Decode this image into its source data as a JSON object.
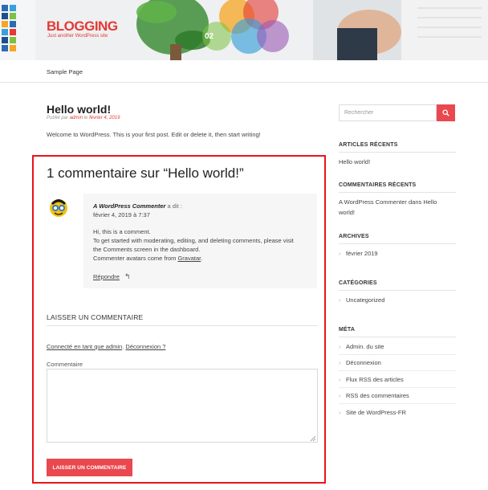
{
  "site": {
    "title": "BLOGGING",
    "tagline": "Just another WordPress site"
  },
  "nav": {
    "items": [
      "Sample Page"
    ]
  },
  "post": {
    "title": "Hello world!",
    "meta_prefix": "Publié par",
    "meta_author": "admin",
    "meta_mid": "le",
    "meta_date": "février 4, 2019",
    "content": "Welcome to WordPress. This is your first post. Edit or delete it, then start writing!"
  },
  "comments": {
    "title": "1 commentaire sur “Hello world!”",
    "items": [
      {
        "author": "A WordPress Commenter",
        "says": "a dit :",
        "date": "février 4, 2019 à 7:37",
        "lines": [
          "Hi, this is a comment.",
          "To get started with moderating, editing, and deleting comments, please visit",
          "the Comments screen in the dashboard.",
          "Commenter avatars come from"
        ],
        "gravatar_link": "Gravatar",
        "reply": "Répondre"
      }
    ]
  },
  "respond": {
    "title": "LAISSER UN COMMENTAIRE",
    "logged_in_prefix": "Connecté en tant que admin",
    "logout": "Déconnexion ?",
    "comment_label": "Commentaire",
    "textarea_value": "",
    "submit_label": "LAISSER UN COMMENTAIRE"
  },
  "sidebar": {
    "search_placeholder": "Rechercher",
    "recent_posts": {
      "title": "ARTICLES RÉCENTS",
      "items": [
        "Hello world!"
      ]
    },
    "recent_comments": {
      "title": "COMMENTAIRES RÉCENTS",
      "line1": "A WordPress Commenter dans Hello",
      "line2": "world!"
    },
    "archives": {
      "title": "ARCHIVES",
      "items": [
        "février 2019"
      ]
    },
    "categories": {
      "title": "CATÉGORIES",
      "items": [
        "Uncategorized"
      ]
    },
    "meta": {
      "title": "MÉTA",
      "items": [
        "Admin. du site",
        "Déconnexion",
        "Flux RSS des articles",
        "RSS des commentaires",
        "Site de WordPress-FR"
      ]
    }
  },
  "colors": {
    "accent": "#e9484f",
    "highlight_border": "#e8131c"
  }
}
